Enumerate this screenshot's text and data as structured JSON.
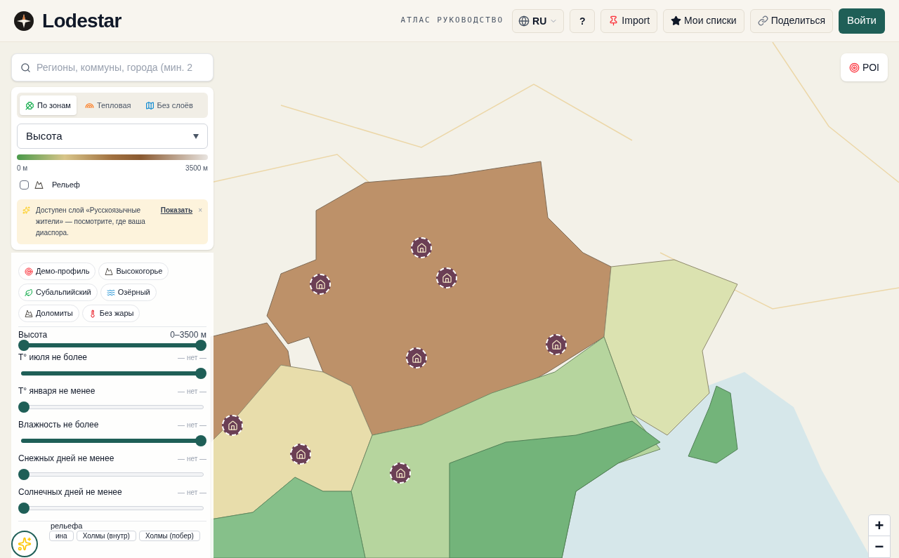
{
  "header": {
    "brand": "Lodestar",
    "nav": "АТЛАС РУКОВОДСТВО",
    "language": "RU",
    "help": "?",
    "actions": [
      "Import",
      "Мои списки",
      "Поделиться"
    ],
    "login": "Войти"
  },
  "search": {
    "placeholder": "Регионы, коммуны, города (мин. 2"
  },
  "layer_tabs": [
    {
      "label": "По зонам",
      "selected": true
    },
    {
      "label": "Тепловая",
      "selected": false
    },
    {
      "label": "Без слоёв",
      "selected": false
    }
  ],
  "metric_select": {
    "value": "Высота"
  },
  "legend": {
    "min": "0 м",
    "max": "3500 м"
  },
  "relief": {
    "label": "Рельеф",
    "checked": false
  },
  "notice": {
    "text": "Доступен слой «Русскоязычные жители» — посмотрите, где ваша диаспора.",
    "link": "Показать",
    "close": "×"
  },
  "presets": [
    "Демо-профиль",
    "Высокогорье",
    "Субальпийский",
    "Озёрный",
    "Доломиты",
    "Без жары"
  ],
  "filters": [
    {
      "kind": "range",
      "label": "Высота",
      "reading": "0–3500 м",
      "thumbs": [
        {
          "level": 0
        },
        {
          "level": 1
        }
      ]
    },
    {
      "kind": "single",
      "label": "T° июля не более",
      "reading": "— нет —",
      "level": 1
    },
    {
      "kind": "single",
      "label": "T° января не менее",
      "reading": "— нет —",
      "level": 0
    },
    {
      "kind": "single",
      "label": "Влажность не более",
      "reading": "— нет —",
      "level": 1
    },
    {
      "kind": "single",
      "label": "Снежных дней не менее",
      "reading": "— нет —",
      "level": 0
    },
    {
      "kind": "single",
      "label": "Солнечных дней не менее",
      "reading": "— нет —",
      "level": 0
    }
  ],
  "terrain": {
    "label": "рельефа",
    "chips": [
      "ина",
      "Холмы (внутр)",
      "Холмы (побер)"
    ]
  },
  "map": {
    "poi": "POI",
    "zoom_in": "+",
    "zoom_out": "−"
  }
}
